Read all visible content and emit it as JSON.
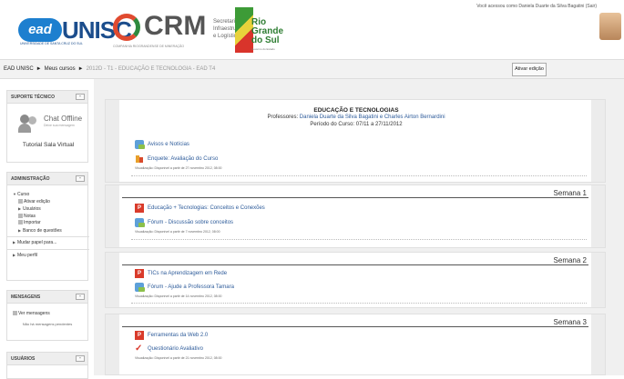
{
  "header": {
    "ead_logo": "ead",
    "unisc_logo": "UNISC",
    "unisc_sub": "UNIVERSIDADE DE SANTA CRUZ DO SUL",
    "crm_logo": "CRM",
    "crm_sub": "COMPANHIA RIOGRANDENSE DE MINERAÇÃO",
    "secretaria": "Secretaria de\nInfraestrutura\ne Logística",
    "rs_logo": "Rio\nGrande\ndo Sul",
    "rs_sub": "Governo do Estado",
    "login_info": "Você acessou como Daniela Duarte da Silva Bagatini (Sair)"
  },
  "navbar": {
    "crumb_home": "EAD UNISC",
    "crumb_courses": "Meus cursos",
    "crumb_current": "2012D - T1 - EDUCAÇÃO E TECNOLOGIA - EAD T4",
    "edit_button": "Ativar edição"
  },
  "sidebar": {
    "support": {
      "title": "SUPORTE TÉCNICO",
      "chat_status": "Chat Offline",
      "chat_sub": "Deixe sua mensagem",
      "tutorial": "Tutorial Sala Virtual"
    },
    "admin": {
      "title": "ADMINISTRAÇÃO",
      "items": {
        "curso": "Curso",
        "ativar": "Ativar edição",
        "usuarios": "Usuários",
        "notas": "Notas",
        "importar": "Importar",
        "banco": "Banco de questões",
        "mudar": "Mudar papel para...",
        "perfil": "Meu perfil"
      }
    },
    "messages": {
      "title": "MENSAGENS",
      "link": "Ver mensagens",
      "none": "Não há mensagens pendentes"
    },
    "users": {
      "title": "USUÁRIOS"
    }
  },
  "course": {
    "title": "EDUCAÇÃO E TECNOLOGIAS",
    "prof_label": "Professores:",
    "prof_names": "Daniela Duarte da Silva Bagatini e Charles Airton Bernardini",
    "period": "Período do Curso: 07/11 a 27/11/2012",
    "intro_activities": {
      "news": "Avisos e Notícias",
      "poll": "Enquete: Avaliação do Curso",
      "poll_vis": "Visualização: Disponível a partir de 27 novembro 2012, 08:00"
    },
    "week1": {
      "title": "Semana 1",
      "page": "Educação + Tecnologias: Conceitos e Conexões",
      "forum": "Fórum - Discussão sobre conceitos",
      "vis": "Visualização: Disponível a partir de 7 novembro 2012, 08:00"
    },
    "week2": {
      "title": "Semana 2",
      "page": "TICs na Aprendizagem em Rede",
      "forum": "Fórum - Ajude a Professora Tamara",
      "vis": "Visualização: Disponível a partir de 14 novembro 2012, 08:00"
    },
    "week3": {
      "title": "Semana 3",
      "page": "Ferramentas da Web 2.0",
      "quiz": "Questionário Avaliativo",
      "vis": "Visualização: Disponível a partir de 21 novembro 2012, 08:00"
    }
  }
}
